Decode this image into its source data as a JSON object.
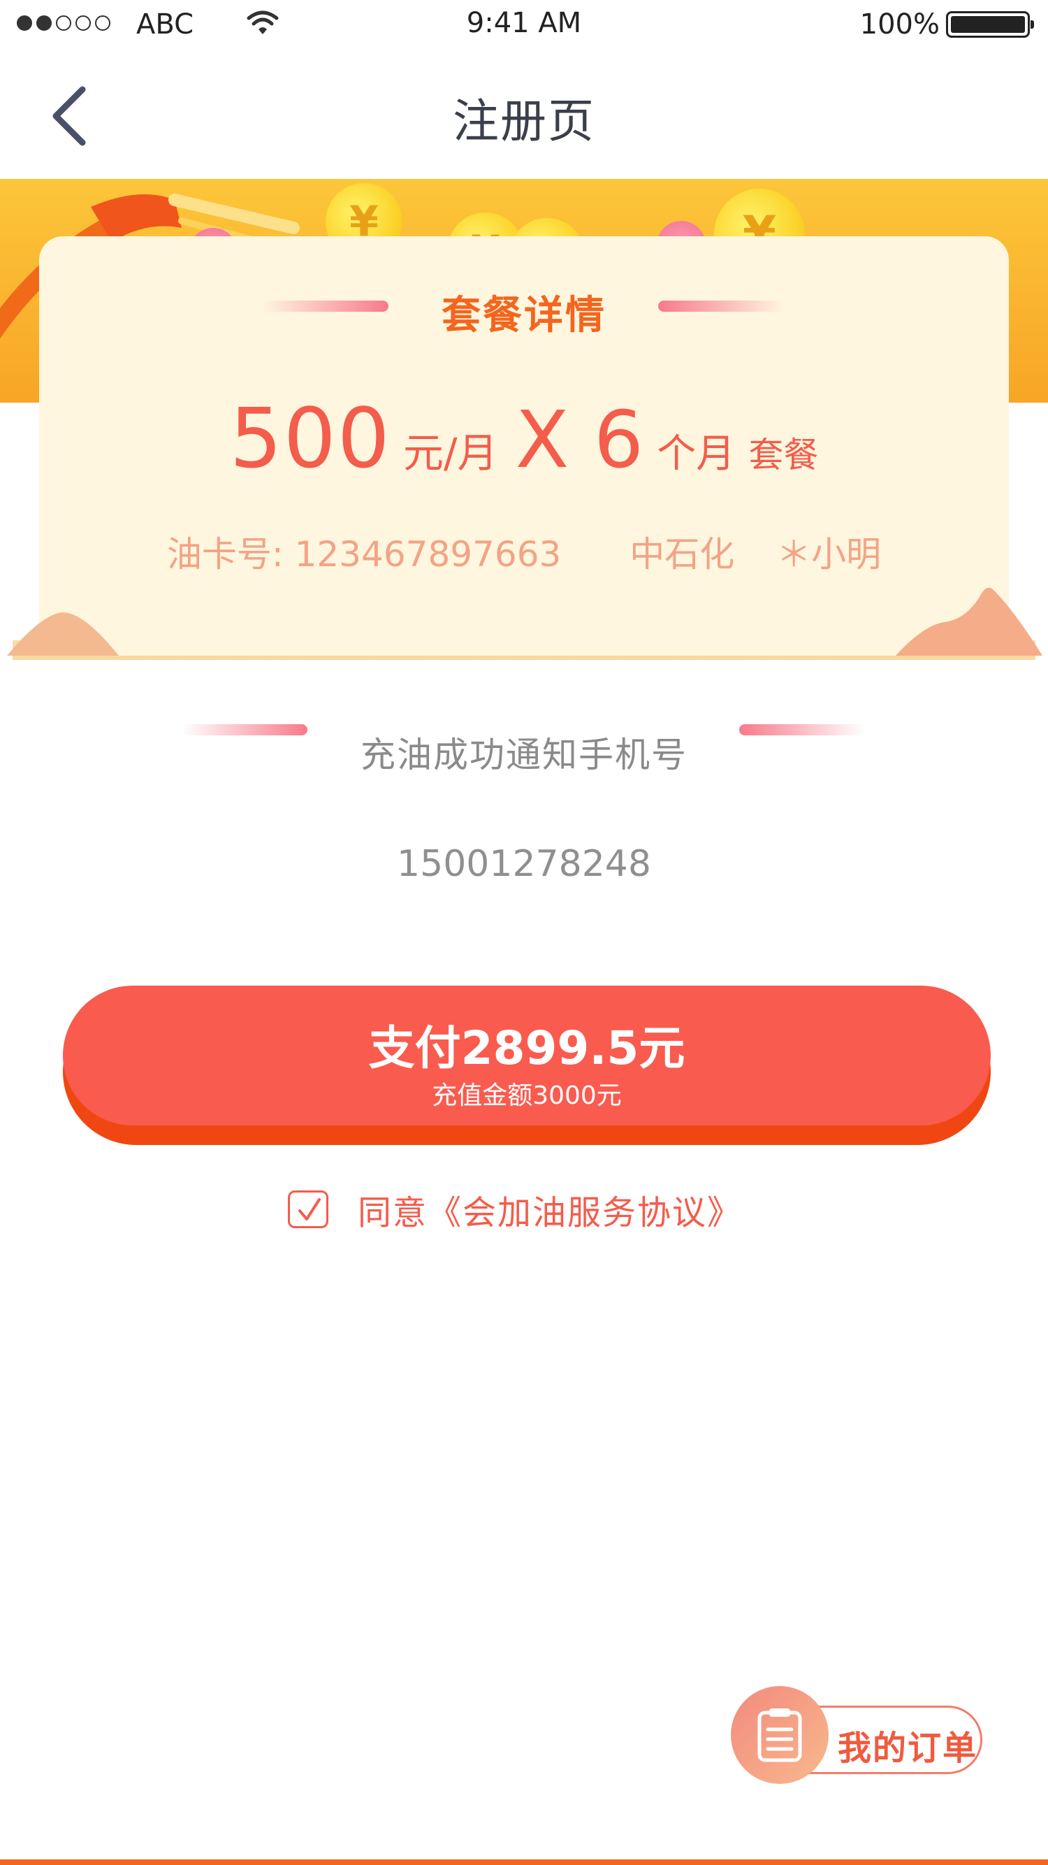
{
  "status_bar": {
    "carrier": "ABC",
    "time": "9:41 AM",
    "battery_percent": "100%"
  },
  "nav": {
    "title": "注册页"
  },
  "plan": {
    "section_title": "套餐详情",
    "amount": "500",
    "unit": "元/月",
    "multiplier": "X 6",
    "months_unit": "个月",
    "suffix": "套餐",
    "card_number": "油卡号: 123467897663",
    "company": "中石化",
    "holder": "＊小明"
  },
  "phone": {
    "label": "充油成功通知手机号",
    "value": "15001278248"
  },
  "pay": {
    "label": "支付2899.5元",
    "sub_label": "充值金额3000元"
  },
  "agreement": {
    "checked": true,
    "text": "同意《会加油服务协议》"
  },
  "orders": {
    "label": "我的订单"
  },
  "colors": {
    "accent": "#f45c4b",
    "button": "#fa5b4f",
    "title_orange": "#f4651e",
    "banner_yellow": "#fcc63a"
  }
}
